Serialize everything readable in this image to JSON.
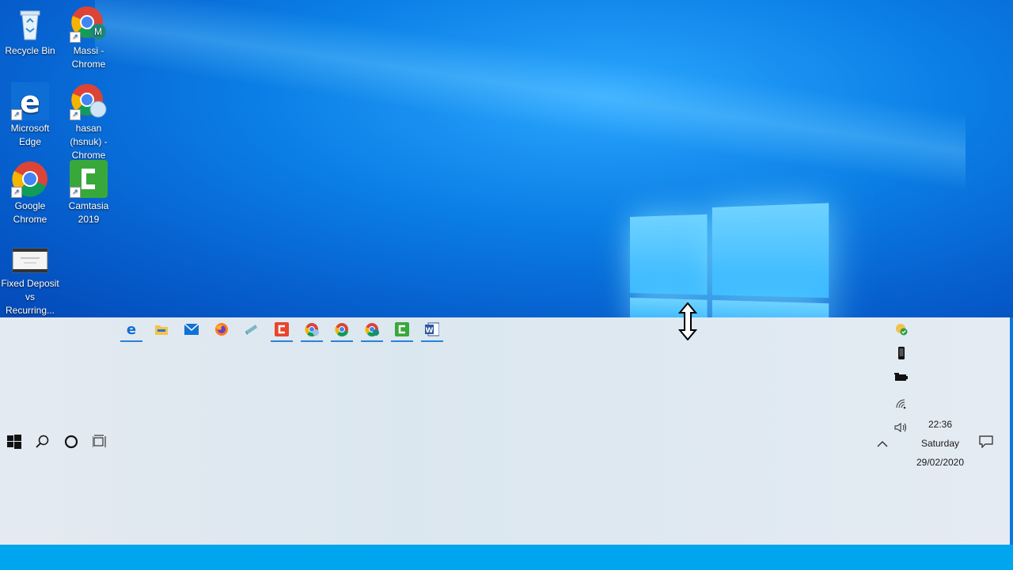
{
  "desktop": {
    "icons": [
      {
        "label": "Recycle Bin"
      },
      {
        "label": "Massi - Chrome"
      },
      {
        "label": "Microsoft Edge"
      },
      {
        "label": "hasan (hsnuk) - Chrome"
      },
      {
        "label": "Google Chrome"
      },
      {
        "label": "Camtasia 2019"
      },
      {
        "label": "Fixed Deposit vs Recurring..."
      }
    ]
  },
  "taskbar": {
    "left_buttons": [
      {
        "icon": "windows-start-icon"
      },
      {
        "icon": "search-icon"
      },
      {
        "icon": "cortana-icon"
      },
      {
        "icon": "task-view-icon"
      }
    ],
    "pinned_apps": [
      {
        "icon": "edge-icon",
        "running": true
      },
      {
        "icon": "file-explorer-icon",
        "running": false
      },
      {
        "icon": "mail-icon",
        "running": false
      },
      {
        "icon": "firefox-icon",
        "running": false
      },
      {
        "icon": "app-icon",
        "running": false
      },
      {
        "icon": "camtasia-recorder-icon",
        "running": true
      },
      {
        "icon": "chrome-profile-icon",
        "running": true
      },
      {
        "icon": "chrome-icon",
        "running": true
      },
      {
        "icon": "chrome-profile-icon",
        "running": true
      },
      {
        "icon": "camtasia-icon",
        "running": true
      },
      {
        "icon": "word-icon",
        "running": true
      }
    ],
    "tray": {
      "icons": [
        "sync-ok-icon",
        "phone-icon",
        "battery-icon",
        "wifi-icon",
        "volume-icon"
      ],
      "clock": {
        "time": "22:36",
        "day": "Saturday",
        "date": "29/02/2020"
      }
    }
  },
  "colors": {
    "accent": "#2b82d8",
    "taskbar_bg": "#e0e9f1",
    "desktop_blue": "#0b7fe6"
  }
}
